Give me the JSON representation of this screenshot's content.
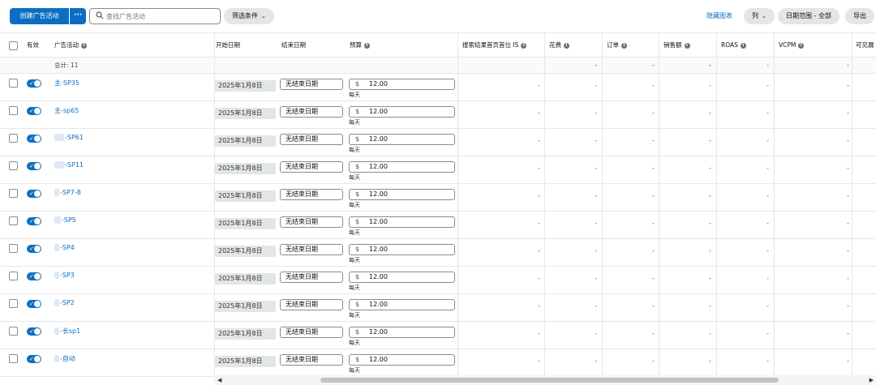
{
  "toolbar": {
    "create_label": "创建广告活动",
    "more_label": "···",
    "search_placeholder": "查找广告活动",
    "filter_label": "筛选条件",
    "hide_chart_label": "隐藏图表",
    "columns_label": "列",
    "date_range_label": "日期范围 - 全部",
    "export_label": "导出"
  },
  "columns": {
    "active": "有效",
    "campaign": "广告活动",
    "start": "开始日期",
    "end": "结束日期",
    "budget": "预算",
    "top_of_search": "搜索结果首页首位 IS",
    "spend": "花费",
    "orders": "订单",
    "sales": "销售额",
    "roas": "ROAS",
    "vcpm": "VCPM",
    "viewable": "可见展"
  },
  "total": {
    "label": "总计: 11",
    "dash": "-"
  },
  "rows": [
    {
      "name": "主-SP35",
      "start": "2025年1月8日",
      "end": "无结束日期",
      "currency": "$",
      "budget": "12.00",
      "per": "每天",
      "dash": "-"
    },
    {
      "name": "主-sp65",
      "start": "2025年1月8日",
      "end": "无结束日期",
      "currency": "$",
      "budget": "12.00",
      "per": "每天",
      "dash": "-"
    },
    {
      "name": "-SP61",
      "start": "2025年1月8日",
      "end": "无结束日期",
      "currency": "$",
      "budget": "12.00",
      "per": "每天",
      "dash": "-"
    },
    {
      "name": "-SP11",
      "start": "2025年1月8日",
      "end": "无结束日期",
      "currency": "$",
      "budget": "12.00",
      "per": "每天",
      "dash": "-"
    },
    {
      "name": "-SP7-8",
      "start": "2025年1月8日",
      "end": "无结束日期",
      "currency": "$",
      "budget": "12.00",
      "per": "每天",
      "dash": "-"
    },
    {
      "name": "-SP5",
      "start": "2025年1月8日",
      "end": "无结束日期",
      "currency": "$",
      "budget": "12.00",
      "per": "每天",
      "dash": "-"
    },
    {
      "name": "-SP4",
      "start": "2025年1月8日",
      "end": "无结束日期",
      "currency": "$",
      "budget": "12.00",
      "per": "每天",
      "dash": "-"
    },
    {
      "name": "-SP3",
      "start": "2025年1月8日",
      "end": "无结束日期",
      "currency": "$",
      "budget": "12.00",
      "per": "每天",
      "dash": "-"
    },
    {
      "name": "-SP2",
      "start": "2025年1月8日",
      "end": "无结束日期",
      "currency": "$",
      "budget": "12.00",
      "per": "每天",
      "dash": "-"
    },
    {
      "name": "-长sp1",
      "start": "2025年1月8日",
      "end": "无结束日期",
      "currency": "$",
      "budget": "12.00",
      "per": "每天",
      "dash": "-"
    },
    {
      "name": "-自动",
      "start": "2025年1月8日",
      "end": "无结束日期",
      "currency": "$",
      "budget": "12.00",
      "per": "每天",
      "dash": "-"
    }
  ],
  "colors": {
    "accent": "#0a6fc2",
    "border": "#e7e7e7"
  },
  "icons": {
    "search": "search-icon",
    "chevron": "chevron-down-icon",
    "info": "info-icon",
    "toggle": "toggle-on-icon"
  }
}
